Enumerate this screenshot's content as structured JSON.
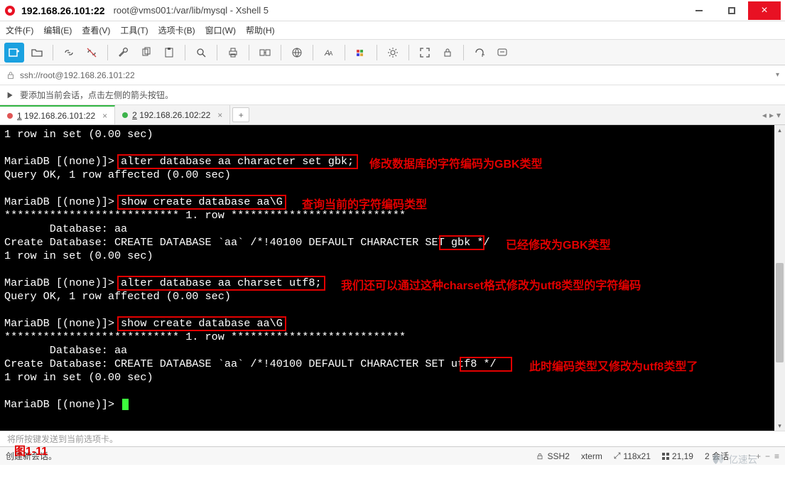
{
  "title": {
    "host": "192.168.26.101:22",
    "full": "root@vms001:/var/lib/mysql - Xshell 5"
  },
  "menu": {
    "file": "文件(F)",
    "edit": "编辑(E)",
    "view": "查看(V)",
    "tools": "工具(T)",
    "tabs_menu": "选项卡(B)",
    "window": "窗口(W)",
    "help": "帮助(H)"
  },
  "address": {
    "url": "ssh://root@192.168.26.101:22"
  },
  "tipbar": {
    "text": "要添加当前会话，点击左侧的箭头按钮。"
  },
  "tabs": [
    {
      "label": "192.168.26.101:22",
      "index": "1",
      "active": true
    },
    {
      "label": "192.168.26.102:22",
      "index": "2",
      "active": false
    }
  ],
  "terminal": {
    "lines": [
      "1 row in set (0.00 sec)",
      "",
      "MariaDB [(none)]> alter database aa character set gbk;",
      "Query OK, 1 row affected (0.00 sec)",
      "",
      "MariaDB [(none)]> show create database aa\\G",
      "*************************** 1. row ***************************",
      "       Database: aa",
      "Create Database: CREATE DATABASE `aa` /*!40100 DEFAULT CHARACTER SET gbk */",
      "1 row in set (0.00 sec)",
      "",
      "MariaDB [(none)]> alter database aa charset utf8;",
      "Query OK, 1 row affected (0.00 sec)",
      "",
      "MariaDB [(none)]> show create database aa\\G",
      "*************************** 1. row ***************************",
      "       Database: aa",
      "Create Database: CREATE DATABASE `aa` /*!40100 DEFAULT CHARACTER SET utf8 */",
      "1 row in set (0.00 sec)",
      "",
      "MariaDB [(none)]> "
    ]
  },
  "annotations": {
    "a1": "修改数据库的字符编码为GBK类型",
    "a2": "查询当前的字符编码类型",
    "a3": "已经修改为GBK类型",
    "a4": "我们还可以通过这种charset格式修改为utf8类型的字符编码",
    "a5": "此时编码类型又修改为utf8类型了",
    "fig": "图1-11"
  },
  "bottom_tip": "将所按键发送到当前选项卡。",
  "status": {
    "left": "创建新会话。",
    "ssh": "SSH2",
    "term": "xterm",
    "size": "118x21",
    "cursor": "21,19",
    "sessions": "2 会话"
  },
  "watermark": "亿速云"
}
